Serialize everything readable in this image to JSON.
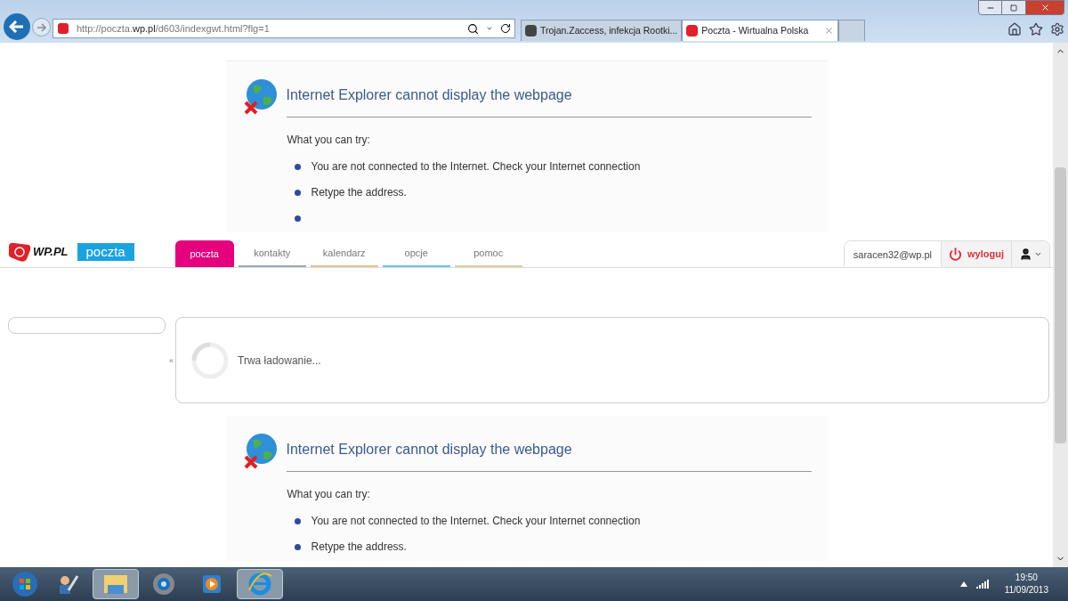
{
  "browser": {
    "address": "http://poczta.**wp.pl**/d603/indexgwt.html?flg=1",
    "tabs": [
      {
        "title": "Trojan.Zaccess, infekcja Rootki...",
        "selected": false
      },
      {
        "title": "Poczta - Wirtualna Polska",
        "selected": true
      }
    ]
  },
  "error_top": {
    "title": "Internet Explorer cannot display the webpage",
    "subtitle": "What you can try:",
    "items": [
      {
        "kind": "text",
        "text": "You are not connected to the Internet. Check your Internet connection"
      },
      {
        "kind": "text",
        "text": "Retype the address."
      },
      {
        "kind": "blank"
      }
    ]
  },
  "mail": {
    "logo": "WP.PL",
    "product": "poczta",
    "nav": [
      {
        "label": "poczta",
        "selected": true,
        "color": "#e5007e"
      },
      {
        "label": "kontakty",
        "selected": false,
        "color": "#9aa8b8"
      },
      {
        "label": "kalendarz",
        "selected": false,
        "color": "#e0c48c"
      },
      {
        "label": "opcje",
        "selected": false,
        "color": "#66c6e0"
      },
      {
        "label": "pomoc",
        "selected": false,
        "color": "#d8d0a0"
      }
    ],
    "user": "saracen32@wp.pl",
    "logout": "wyloguj",
    "collapse": "«",
    "loading": "Trwa ładowanie..."
  },
  "error_bottom": {
    "title": "Internet Explorer cannot display the webpage",
    "subtitle": "What you can try:",
    "items": [
      {
        "kind": "text",
        "text": "You are not connected to the Internet. Check your Internet connection"
      },
      {
        "kind": "text",
        "text": "Retype the address."
      }
    ]
  },
  "taskbar": {
    "apps": [
      {
        "open": false
      },
      {
        "open": true
      },
      {
        "open": false
      },
      {
        "open": false
      },
      {
        "open": true
      }
    ],
    "time": "19:50",
    "date": "11/09/2013"
  }
}
